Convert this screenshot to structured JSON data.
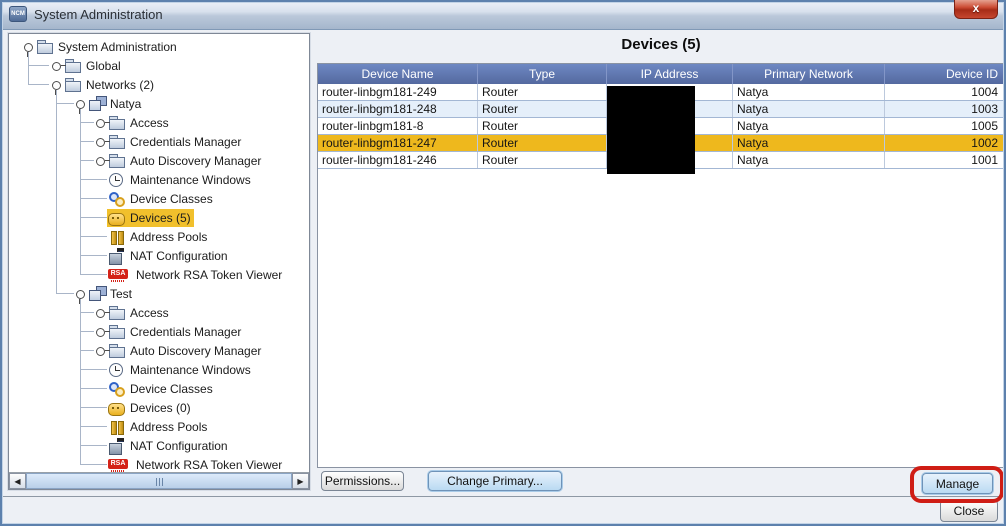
{
  "window": {
    "title": "System Administration",
    "app_icon_label": "NCM",
    "close_button_glyph": "x"
  },
  "sidebar": {
    "items": [
      {
        "label": "System Administration",
        "level": 0,
        "icon": "folder",
        "handle": "expanded",
        "selected": false
      },
      {
        "label": "Global",
        "level": 1,
        "icon": "folder",
        "handle": "collapsed",
        "selected": false
      },
      {
        "label": "Networks (2)",
        "level": 1,
        "icon": "folder",
        "handle": "expanded",
        "selected": false
      },
      {
        "label": "Natya",
        "level": 2,
        "icon": "network",
        "handle": "expanded",
        "selected": false
      },
      {
        "label": "Access",
        "level": 3,
        "icon": "folder",
        "handle": "collapsed",
        "selected": false
      },
      {
        "label": "Credentials Manager",
        "level": 3,
        "icon": "folder",
        "handle": "collapsed",
        "selected": false
      },
      {
        "label": "Auto Discovery Manager",
        "level": 3,
        "icon": "folder",
        "handle": "collapsed",
        "selected": false
      },
      {
        "label": "Maintenance Windows",
        "level": 3,
        "icon": "clock",
        "handle": "none",
        "selected": false
      },
      {
        "label": "Device Classes",
        "level": 3,
        "icon": "keys",
        "handle": "none",
        "selected": false
      },
      {
        "label": "Devices (5)",
        "level": 3,
        "icon": "devices",
        "handle": "none",
        "selected": true
      },
      {
        "label": "Address Pools",
        "level": 3,
        "icon": "pools",
        "handle": "none",
        "selected": false
      },
      {
        "label": "NAT Configuration",
        "level": 3,
        "icon": "nat",
        "handle": "none",
        "selected": false
      },
      {
        "label": "Network RSA Token Viewer",
        "level": 3,
        "icon": "rsa",
        "handle": "none",
        "selected": false
      },
      {
        "label": "Test",
        "level": 2,
        "icon": "network",
        "handle": "expanded",
        "selected": false
      },
      {
        "label": "Access",
        "level": 3,
        "icon": "folder",
        "handle": "collapsed",
        "selected": false
      },
      {
        "label": "Credentials Manager",
        "level": 3,
        "icon": "folder",
        "handle": "collapsed",
        "selected": false
      },
      {
        "label": "Auto Discovery Manager",
        "level": 3,
        "icon": "folder",
        "handle": "collapsed",
        "selected": false
      },
      {
        "label": "Maintenance Windows",
        "level": 3,
        "icon": "clock",
        "handle": "none",
        "selected": false
      },
      {
        "label": "Device Classes",
        "level": 3,
        "icon": "keys",
        "handle": "none",
        "selected": false
      },
      {
        "label": "Devices (0)",
        "level": 3,
        "icon": "devices",
        "handle": "none",
        "selected": false
      },
      {
        "label": "Address Pools",
        "level": 3,
        "icon": "pools",
        "handle": "none",
        "selected": false
      },
      {
        "label": "NAT Configuration",
        "level": 3,
        "icon": "nat",
        "handle": "none",
        "selected": false
      },
      {
        "label": "Network RSA Token Viewer",
        "level": 3,
        "icon": "rsa",
        "handle": "none",
        "selected": false
      }
    ],
    "scrollbar": {
      "left_arrow": "◀",
      "right_arrow": "▶"
    }
  },
  "main": {
    "title": "Devices (5)",
    "table": {
      "columns": [
        "Device Name",
        "Type",
        "IP Address",
        "Primary Network",
        "Device ID"
      ],
      "rows": [
        {
          "cells": [
            "router-linbgm181-249",
            "Router",
            "",
            "Natya",
            "1004"
          ],
          "selected": false
        },
        {
          "cells": [
            "router-linbgm181-248",
            "Router",
            "",
            "Natya",
            "1003"
          ],
          "selected": false
        },
        {
          "cells": [
            "router-linbgm181-8",
            "Router",
            "",
            "Natya",
            "1005"
          ],
          "selected": false
        },
        {
          "cells": [
            "router-linbgm181-247",
            "Router",
            "",
            "Natya",
            "1002"
          ],
          "selected": true
        },
        {
          "cells": [
            "router-linbgm181-246",
            "Router",
            "",
            "Natya",
            "1001"
          ],
          "selected": false
        }
      ],
      "redaction": "IP Address values covered by black box"
    },
    "buttons": {
      "permissions": "Permissions...",
      "change_primary": "Change Primary...",
      "manage": "Manage"
    }
  },
  "footer": {
    "close": "Close"
  },
  "colors": {
    "selection_yellow": "#f1c02c",
    "selected_row_orange": "#eeb81d",
    "table_header_blue": "#5b76b8",
    "alt_row_blue": "#e5effa",
    "annotation_red": "#cf1d15",
    "close_button_red": "#c64730"
  }
}
